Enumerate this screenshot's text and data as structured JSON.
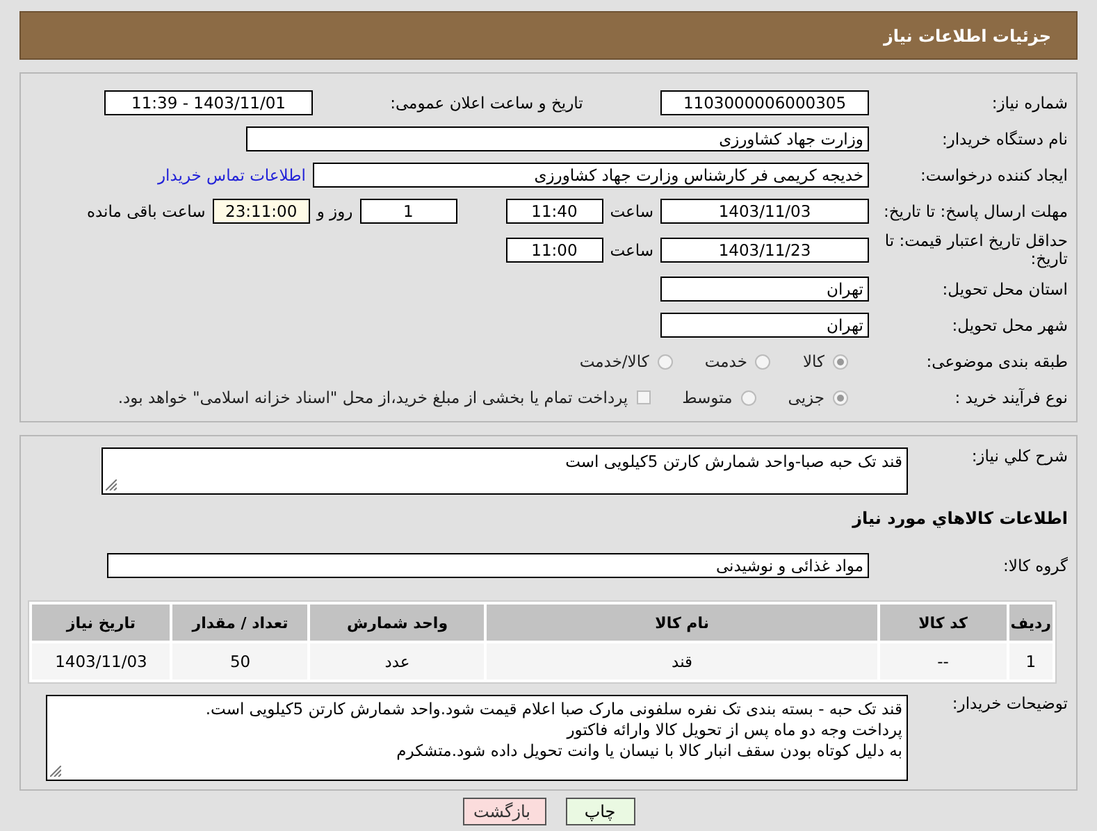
{
  "header": {
    "title": "جزئیات اطلاعات نیاز"
  },
  "need_number": {
    "label": "شماره نیاز:",
    "value": "1103000006000305"
  },
  "announce": {
    "label": "تاریخ و ساعت اعلان عمومی:",
    "value": "1403/11/01 - 11:39"
  },
  "buyer_org": {
    "label": "نام دستگاه خریدار:",
    "value": "وزارت جهاد کشاورزی"
  },
  "creator": {
    "label": "ایجاد کننده درخواست:",
    "value": "خدیجه کریمی فر کارشناس وزارت جهاد کشاورزی",
    "link": "اطلاعات تماس خریدار"
  },
  "reply_deadline": {
    "label": "مهلت ارسال پاسخ: تا تاریخ:",
    "date": "1403/11/03",
    "time_label": "ساعت",
    "time": "11:40",
    "days": "1",
    "days_label": "روز و",
    "remaining": "23:11:00",
    "remaining_label": "ساعت باقی مانده"
  },
  "price_validity": {
    "label": "حداقل تاریخ اعتبار قیمت: تا تاریخ:",
    "date": "1403/11/23",
    "time_label": "ساعت",
    "time": "11:00"
  },
  "province": {
    "label": "استان محل تحویل:",
    "value": "تهران"
  },
  "city": {
    "label": "شهر محل تحویل:",
    "value": "تهران"
  },
  "category": {
    "label": "طبقه بندی موضوعی:",
    "options": [
      {
        "kind": "radio",
        "label": "کالا",
        "selected": true
      },
      {
        "kind": "radio",
        "label": "خدمت",
        "selected": false
      },
      {
        "kind": "radio",
        "label": "کالا/خدمت",
        "selected": false
      }
    ]
  },
  "process": {
    "label": "نوع فرآیند خرید :",
    "options": [
      {
        "kind": "radio",
        "label": "جزیی",
        "selected": true
      },
      {
        "kind": "radio",
        "label": "متوسط",
        "selected": false
      },
      {
        "kind": "checkbox",
        "label": "پرداخت تمام یا بخشی از مبلغ خرید،از محل \"اسناد خزانه اسلامی\" خواهد بود.",
        "selected": false
      }
    ]
  },
  "summary": {
    "label": "شرح کلي نياز:",
    "value": "قند تک حبه صبا-واحد شمارش کارتن 5کیلویی است"
  },
  "items_heading": "اطلاعات کالاهاي مورد نياز",
  "goods_group": {
    "label": "گروه کالا:",
    "value": "مواد غذائی و نوشیدنی"
  },
  "table": {
    "columns": [
      "ردیف",
      "کد کالا",
      "نام کالا",
      "واحد شمارش",
      "تعداد / مقدار",
      "تاریخ نیاز"
    ],
    "rows": [
      [
        "1",
        "--",
        "قند",
        "عدد",
        "50",
        "1403/11/03"
      ]
    ]
  },
  "buyer_notes": {
    "label": "توضیحات خریدار:",
    "lines": [
      "قند تک حبه - بسته بندی تک نفره سلفونی مارک صبا اعلام قیمت شود.واحد شمارش کارتن 5کیلویی است.",
      "پرداخت وجه دو ماه پس از تحویل کالا وارائه فاکتور",
      "به دلیل کوتاه بودن سقف انبار کالا با نیسان یا وانت تحویل داده شود.متشکرم"
    ]
  },
  "buttons": [
    {
      "kind": "print",
      "label": "چاپ"
    },
    {
      "kind": "back",
      "label": "بازگشت"
    }
  ]
}
